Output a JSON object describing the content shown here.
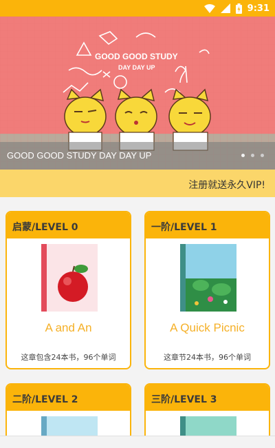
{
  "status_bar": {
    "time": "9:31",
    "icons": [
      "wifi-icon",
      "signal-icon",
      "battery-icon"
    ],
    "color": "#fbb40a"
  },
  "banner": {
    "caption": "GOOD GOOD STUDY DAY DAY UP",
    "art_line1": "GOOD GOOD STUDY",
    "art_line2": "DAY DAY UP",
    "slide_count": 3,
    "active_slide": 1
  },
  "promo": {
    "text": "注册就送永久VIP!"
  },
  "levels": [
    {
      "header": "启蒙/LEVEL 0",
      "book_title": "A and An",
      "desc": "这章包含24本书，96个单词",
      "cover": "apple-cover"
    },
    {
      "header": "一阶/LEVEL 1",
      "book_title": "A Quick Picnic",
      "desc": "这章节24本书，96个单词",
      "cover": "picnic-cover"
    },
    {
      "header": "二阶/LEVEL 2",
      "book_title": "",
      "desc": "",
      "cover": "blue-cover"
    },
    {
      "header": "三阶/LEVEL 3",
      "book_title": "",
      "desc": "",
      "cover": "teal-cover"
    }
  ],
  "colors": {
    "accent": "#fbb40a",
    "promo_bg": "#fbd66a",
    "banner_bg": "#f07c7a",
    "title_text": "#f5b027"
  }
}
